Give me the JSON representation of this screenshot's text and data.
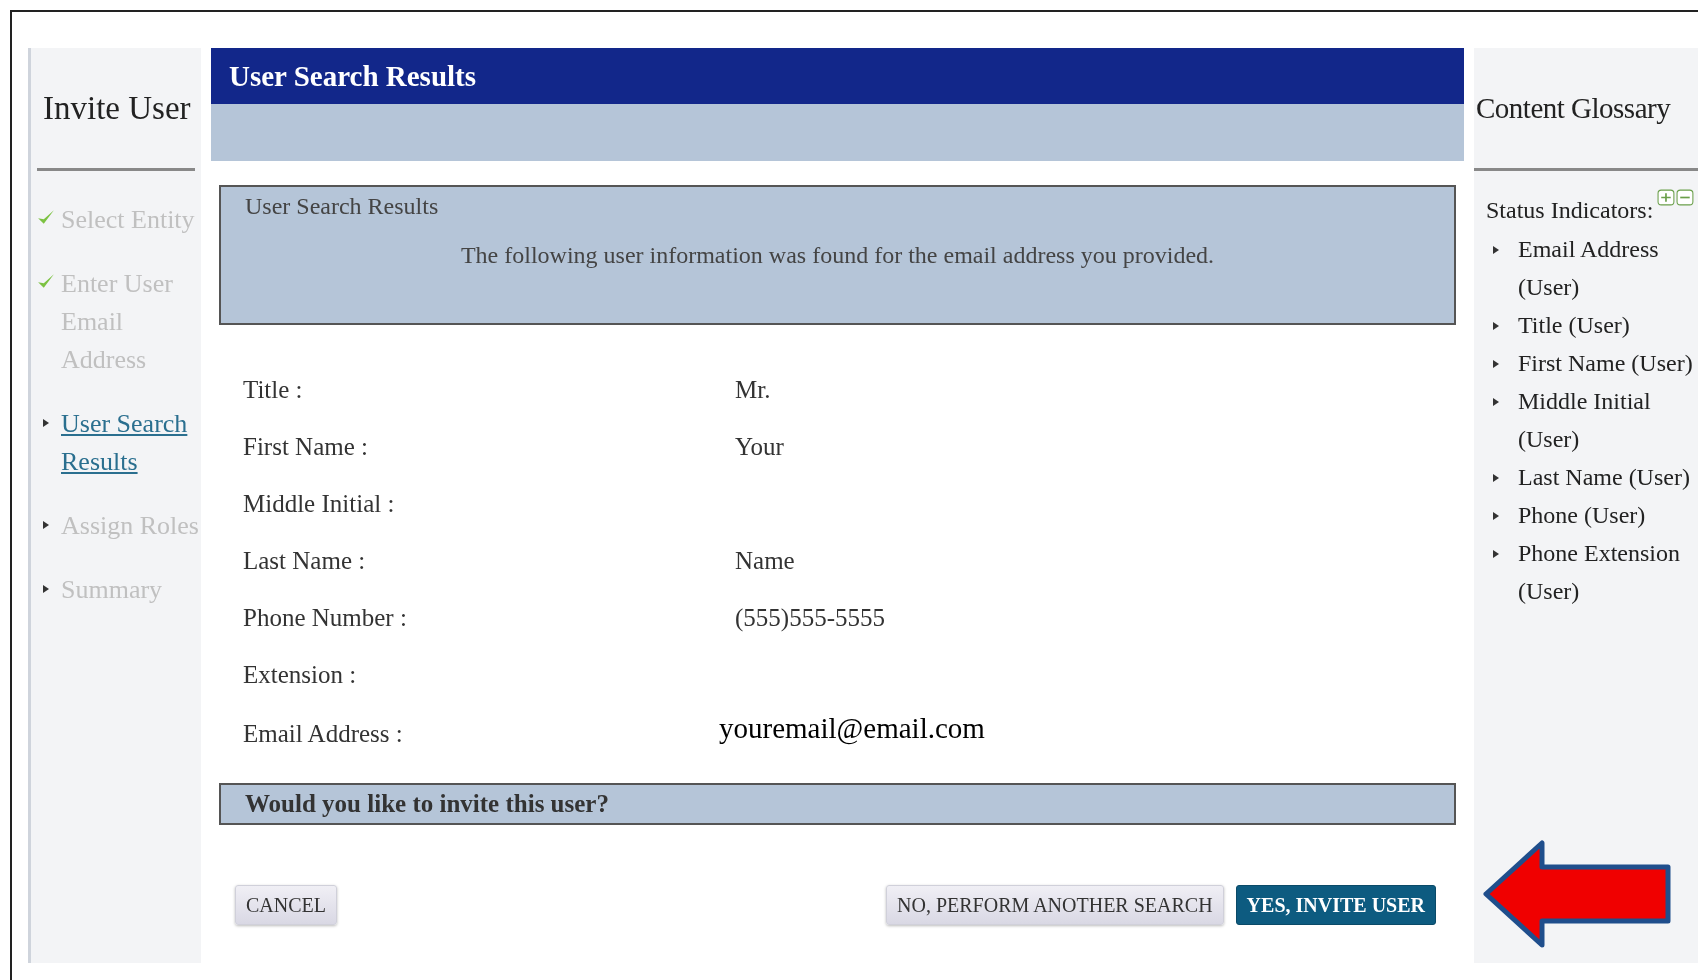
{
  "sidebar": {
    "title": "Invite User",
    "steps": [
      {
        "label": "Select Entity",
        "completed": true,
        "selected": false
      },
      {
        "label": "Enter User Email Address",
        "completed": true,
        "selected": false
      },
      {
        "label": "User Search Results",
        "completed": false,
        "selected": true
      },
      {
        "label": "Assign Roles",
        "completed": false,
        "selected": false
      },
      {
        "label": "Summary",
        "completed": false,
        "selected": false
      }
    ]
  },
  "main": {
    "title": "User Search Results",
    "panel": {
      "title": "User Search Results",
      "message": "The following user information was found for the email address you provided."
    },
    "fields": [
      {
        "label": "Title :",
        "value": "Mr.",
        "kind": "standard"
      },
      {
        "label": "First Name :",
        "value": "Your",
        "kind": "standard"
      },
      {
        "label": "Middle Initial :",
        "kind": "standard"
      },
      {
        "label": "Last Name :",
        "value": "Name",
        "kind": "standard"
      },
      {
        "label": "Phone Number :",
        "value": "(555)555-5555",
        "kind": "standard"
      },
      {
        "label": "Extension :",
        "kind": "standard"
      },
      {
        "label": "Email Address :",
        "value": "youremail@email.com",
        "kind": "large"
      }
    ],
    "question": "Would you like to invite this user?",
    "buttons": [
      {
        "label": "CANCEL",
        "kind": "secondary"
      },
      {
        "label": "NO, PERFORM ANOTHER SEARCH",
        "kind": "secondary"
      },
      {
        "label": "YES, INVITE USER",
        "kind": "primary"
      }
    ]
  },
  "glossary": {
    "title": "Content Glossary",
    "heading": "Status Indicators:",
    "items": [
      "Email Address (User)",
      "Title (User)",
      "First Name (User)",
      "Middle Initial (User)",
      "Last Name (User)",
      "Phone (User)",
      "Phone Extension (User)"
    ]
  }
}
